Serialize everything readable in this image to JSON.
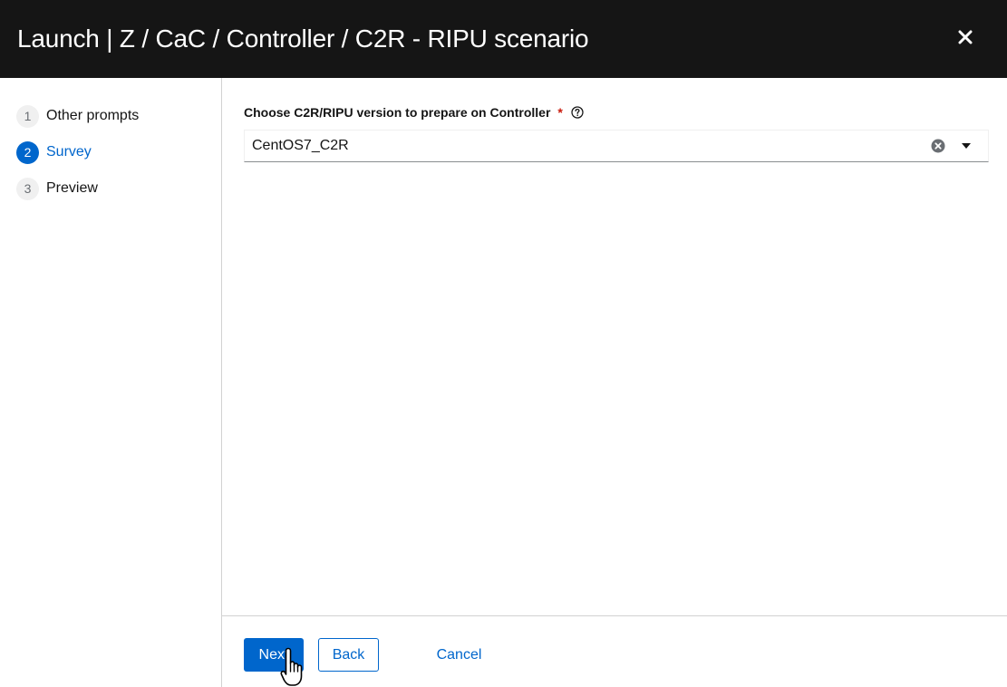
{
  "modal": {
    "title": "Launch | Z / CaC / Controller / C2R - RIPU scenario",
    "close_icon": "close-icon"
  },
  "wizard": {
    "steps": [
      {
        "number": "1",
        "label": "Other prompts",
        "current": false
      },
      {
        "number": "2",
        "label": "Survey",
        "current": true
      },
      {
        "number": "3",
        "label": "Preview",
        "current": false
      }
    ]
  },
  "survey": {
    "question_label": "Choose C2R/RIPU version to prepare on Controller",
    "required_marker": "*",
    "help_icon": "help-icon",
    "selected_value": "CentOS7_C2R"
  },
  "footer": {
    "next_label": "Next",
    "back_label": "Back",
    "cancel_label": "Cancel"
  },
  "colors": {
    "header_bg": "#151515",
    "accent": "#0066cc",
    "required": "#c9190b"
  }
}
